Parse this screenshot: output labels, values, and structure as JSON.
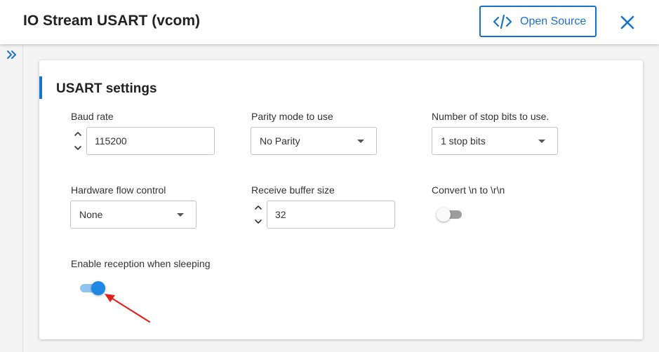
{
  "header": {
    "title": "IO Stream USART (vcom)",
    "open_source_label": "Open Source",
    "open_source_icon": "code-icon",
    "close_icon": "close-icon"
  },
  "sidebar": {
    "expand_icon": "double-chevron-right-icon"
  },
  "section": {
    "title": "USART settings"
  },
  "fields": {
    "baud_rate": {
      "label": "Baud rate",
      "value": "115200"
    },
    "parity_mode": {
      "label": "Parity mode to use",
      "value": "No Parity"
    },
    "stop_bits": {
      "label": "Number of stop bits to use.",
      "value": "1 stop bits"
    },
    "flow_control": {
      "label": "Hardware flow control",
      "value": "None"
    },
    "rx_buffer": {
      "label": "Receive buffer size",
      "value": "32"
    },
    "convert_newline": {
      "label": "Convert \\n to \\r\\n",
      "enabled": false
    },
    "rx_sleeping": {
      "label": "Enable reception when sleeping",
      "enabled": true
    }
  },
  "colors": {
    "accent": "#1a73c9",
    "toggle_on": "#1e88e5",
    "annotation_arrow": "#e0201a"
  }
}
